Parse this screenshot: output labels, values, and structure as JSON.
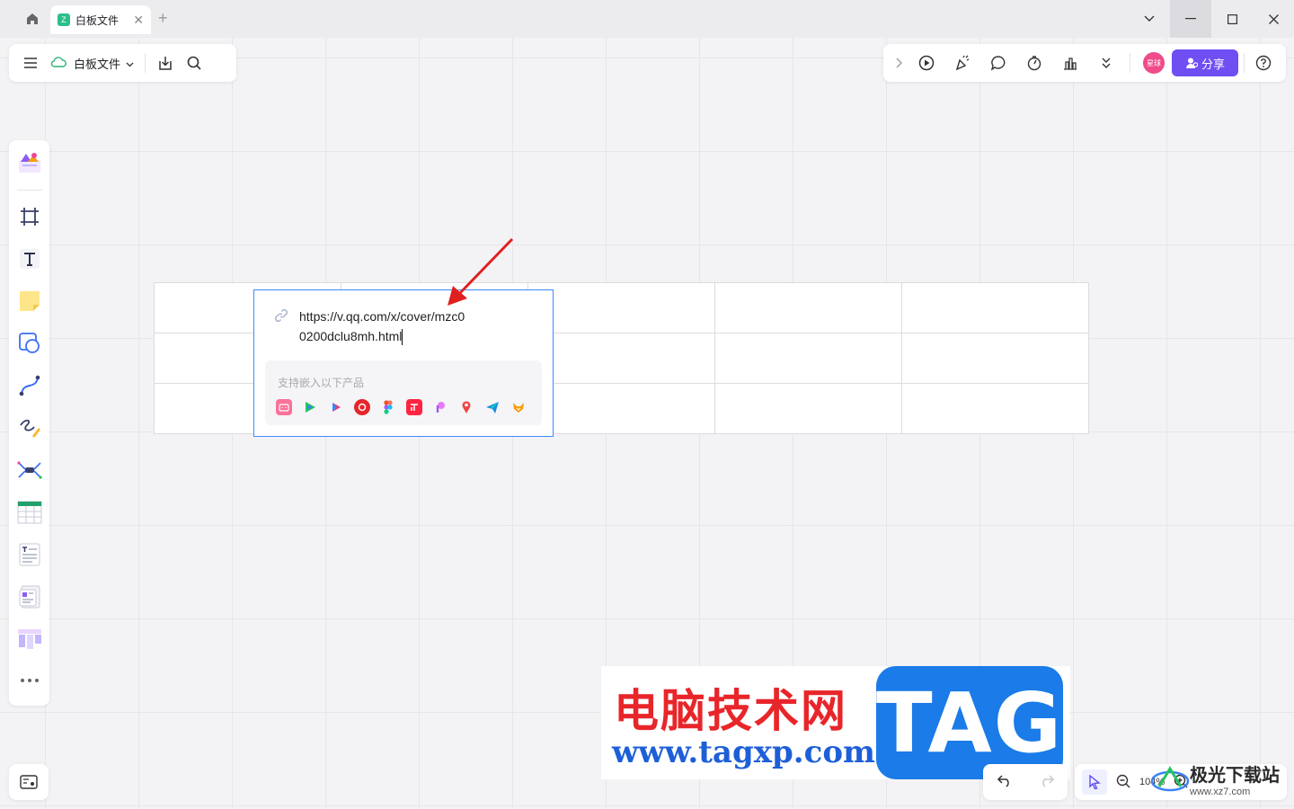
{
  "titlebar": {
    "tab_title": "白板文件",
    "tab_logo": "Z",
    "tab_close": "✕",
    "tab_add": "+"
  },
  "toolbar_left": {
    "file_name": "白板文件"
  },
  "toolbar_right": {
    "avatar_text": "星球",
    "share_label": "分享"
  },
  "embed": {
    "url": "https://v.qq.com/x/cover/mzc00200dclu8mh.html",
    "products_label": "支持嵌入以下产品",
    "products": [
      "bilibili-icon",
      "tencent-video-icon",
      "youku-icon",
      "netease-music-icon",
      "figma-icon",
      "xiaohongshu-icon",
      "processon-icon",
      "map-pin-icon",
      "feishu-icon",
      "fox-icon"
    ],
    "border_color": "#3d8bff"
  },
  "table": {
    "rows": 3,
    "cols": 5
  },
  "watermark": {
    "cn": "电脑技术网",
    "url": "www.tagxp.com",
    "tag": "TAG"
  },
  "zoom": {
    "level": "104%"
  },
  "logo_watermark": {
    "cn": "极光下载站",
    "en": "www.xz7.com"
  },
  "colors": {
    "accent": "#6f4ef2",
    "arrow": "#e02020",
    "selection": "#3d8bff"
  }
}
